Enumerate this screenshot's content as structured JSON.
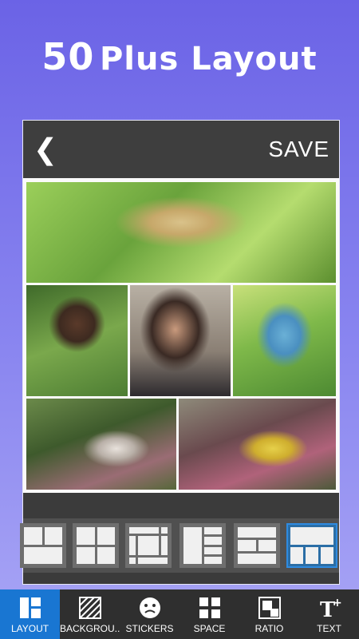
{
  "headline": {
    "number": "50",
    "text": "Plus Layout"
  },
  "topbar": {
    "back_glyph": "❮",
    "save_label": "SAVE"
  },
  "layouts": {
    "selected_index": 5,
    "count": 6
  },
  "bottom_nav": [
    {
      "label": "LAYOUT",
      "icon": "layout-icon",
      "active": true
    },
    {
      "label": "BACKGROU...",
      "icon": "background-icon",
      "active": false
    },
    {
      "label": "STICKERS",
      "icon": "sticker-face-icon",
      "active": false
    },
    {
      "label": "SPACE",
      "icon": "space-grid-icon",
      "active": false
    },
    {
      "label": "RATIO",
      "icon": "ratio-icon",
      "active": false
    },
    {
      "label": "TEXT",
      "icon": "text-add-icon",
      "active": false
    }
  ],
  "colors": {
    "accent": "#1976d2",
    "selected_layout": "#2b6ea6",
    "bg_top": "#6b63e6",
    "bg_bottom": "#a9a6f5"
  }
}
